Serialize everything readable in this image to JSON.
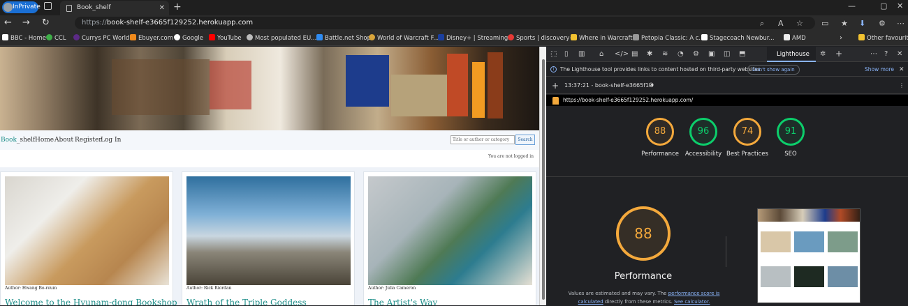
{
  "browser": {
    "inprivate_label": "InPrivate",
    "tab_title": "Book_shelf",
    "url_prefix": "https://",
    "url_host": "book-shelf-e3665f129252.herokuapp.com",
    "bookmarks": [
      {
        "label": "BBC - Home",
        "color": "#ffffff"
      },
      {
        "label": "CCL",
        "color": "#3fae49"
      },
      {
        "label": "Currys PC World",
        "color": "#5b2a86"
      },
      {
        "label": "Ebuyer.com",
        "color": "#f08a1c"
      },
      {
        "label": "Google",
        "color": "#ffffff"
      },
      {
        "label": "YouTube",
        "color": "#ff0000"
      },
      {
        "label": "Most populated EU...",
        "color": "#bbbbbb"
      },
      {
        "label": "Battle.net Shop",
        "color": "#2f8cf3"
      },
      {
        "label": "World of Warcraft F...",
        "color": "#d8a43a"
      },
      {
        "label": "Disney+ | Streaming...",
        "color": "#1a3fa0"
      },
      {
        "label": "Sports | discovery+",
        "color": "#e53935"
      },
      {
        "label": "Where in Warcraft?",
        "color": "#f2c230"
      },
      {
        "label": "Petopia Classic: A c...",
        "color": "#999999"
      },
      {
        "label": "Stagecoach Newbur...",
        "color": "#ffffff"
      },
      {
        "label": "AMD",
        "color": "#eeeeee"
      }
    ],
    "other_favourites": "Other favourites"
  },
  "site": {
    "brand_a": "Book",
    "brand_b": "_shelf",
    "nav": [
      "Home",
      "About",
      "Register",
      "Log In"
    ],
    "search_placeholder": "Title or author or category",
    "search_button": "Search",
    "status": "You are not logged in",
    "cards": [
      {
        "author": "Author: Hwang Bo-reum",
        "title": "Welcome to the Hyunam-dong Bookshop"
      },
      {
        "author": "Author: Rick Riordan",
        "title": "Wrath of the Triple Goddess"
      },
      {
        "author": "Author: Julia Cameron",
        "title": "The Artist's Way"
      }
    ]
  },
  "devtools": {
    "panel_tab": "Lighthouse",
    "info_message": "The Lighthouse tool provides links to content hosted on third-party websites.",
    "dont_show": "Don't show again",
    "show_more": "Show more",
    "report_label": "13:37:21 - book-shelf-e3665f1",
    "report_url": "https://book-shelf-e3665f129252.herokuapp.com/",
    "scores": [
      {
        "value": "88",
        "label": "Performance",
        "color": "#f4a93c"
      },
      {
        "value": "96",
        "label": "Accessibility",
        "color": "#0cce6b"
      },
      {
        "value": "74",
        "label": "Best Practices",
        "color": "#f4a93c"
      },
      {
        "value": "91",
        "label": "SEO",
        "color": "#0cce6b"
      }
    ],
    "big_score": "88",
    "big_label": "Performance",
    "note_a": "Values are estimated and may vary. The ",
    "note_link1": "performance score is calculated",
    "note_b": " directly from these metrics. ",
    "note_link2": "See calculator."
  }
}
